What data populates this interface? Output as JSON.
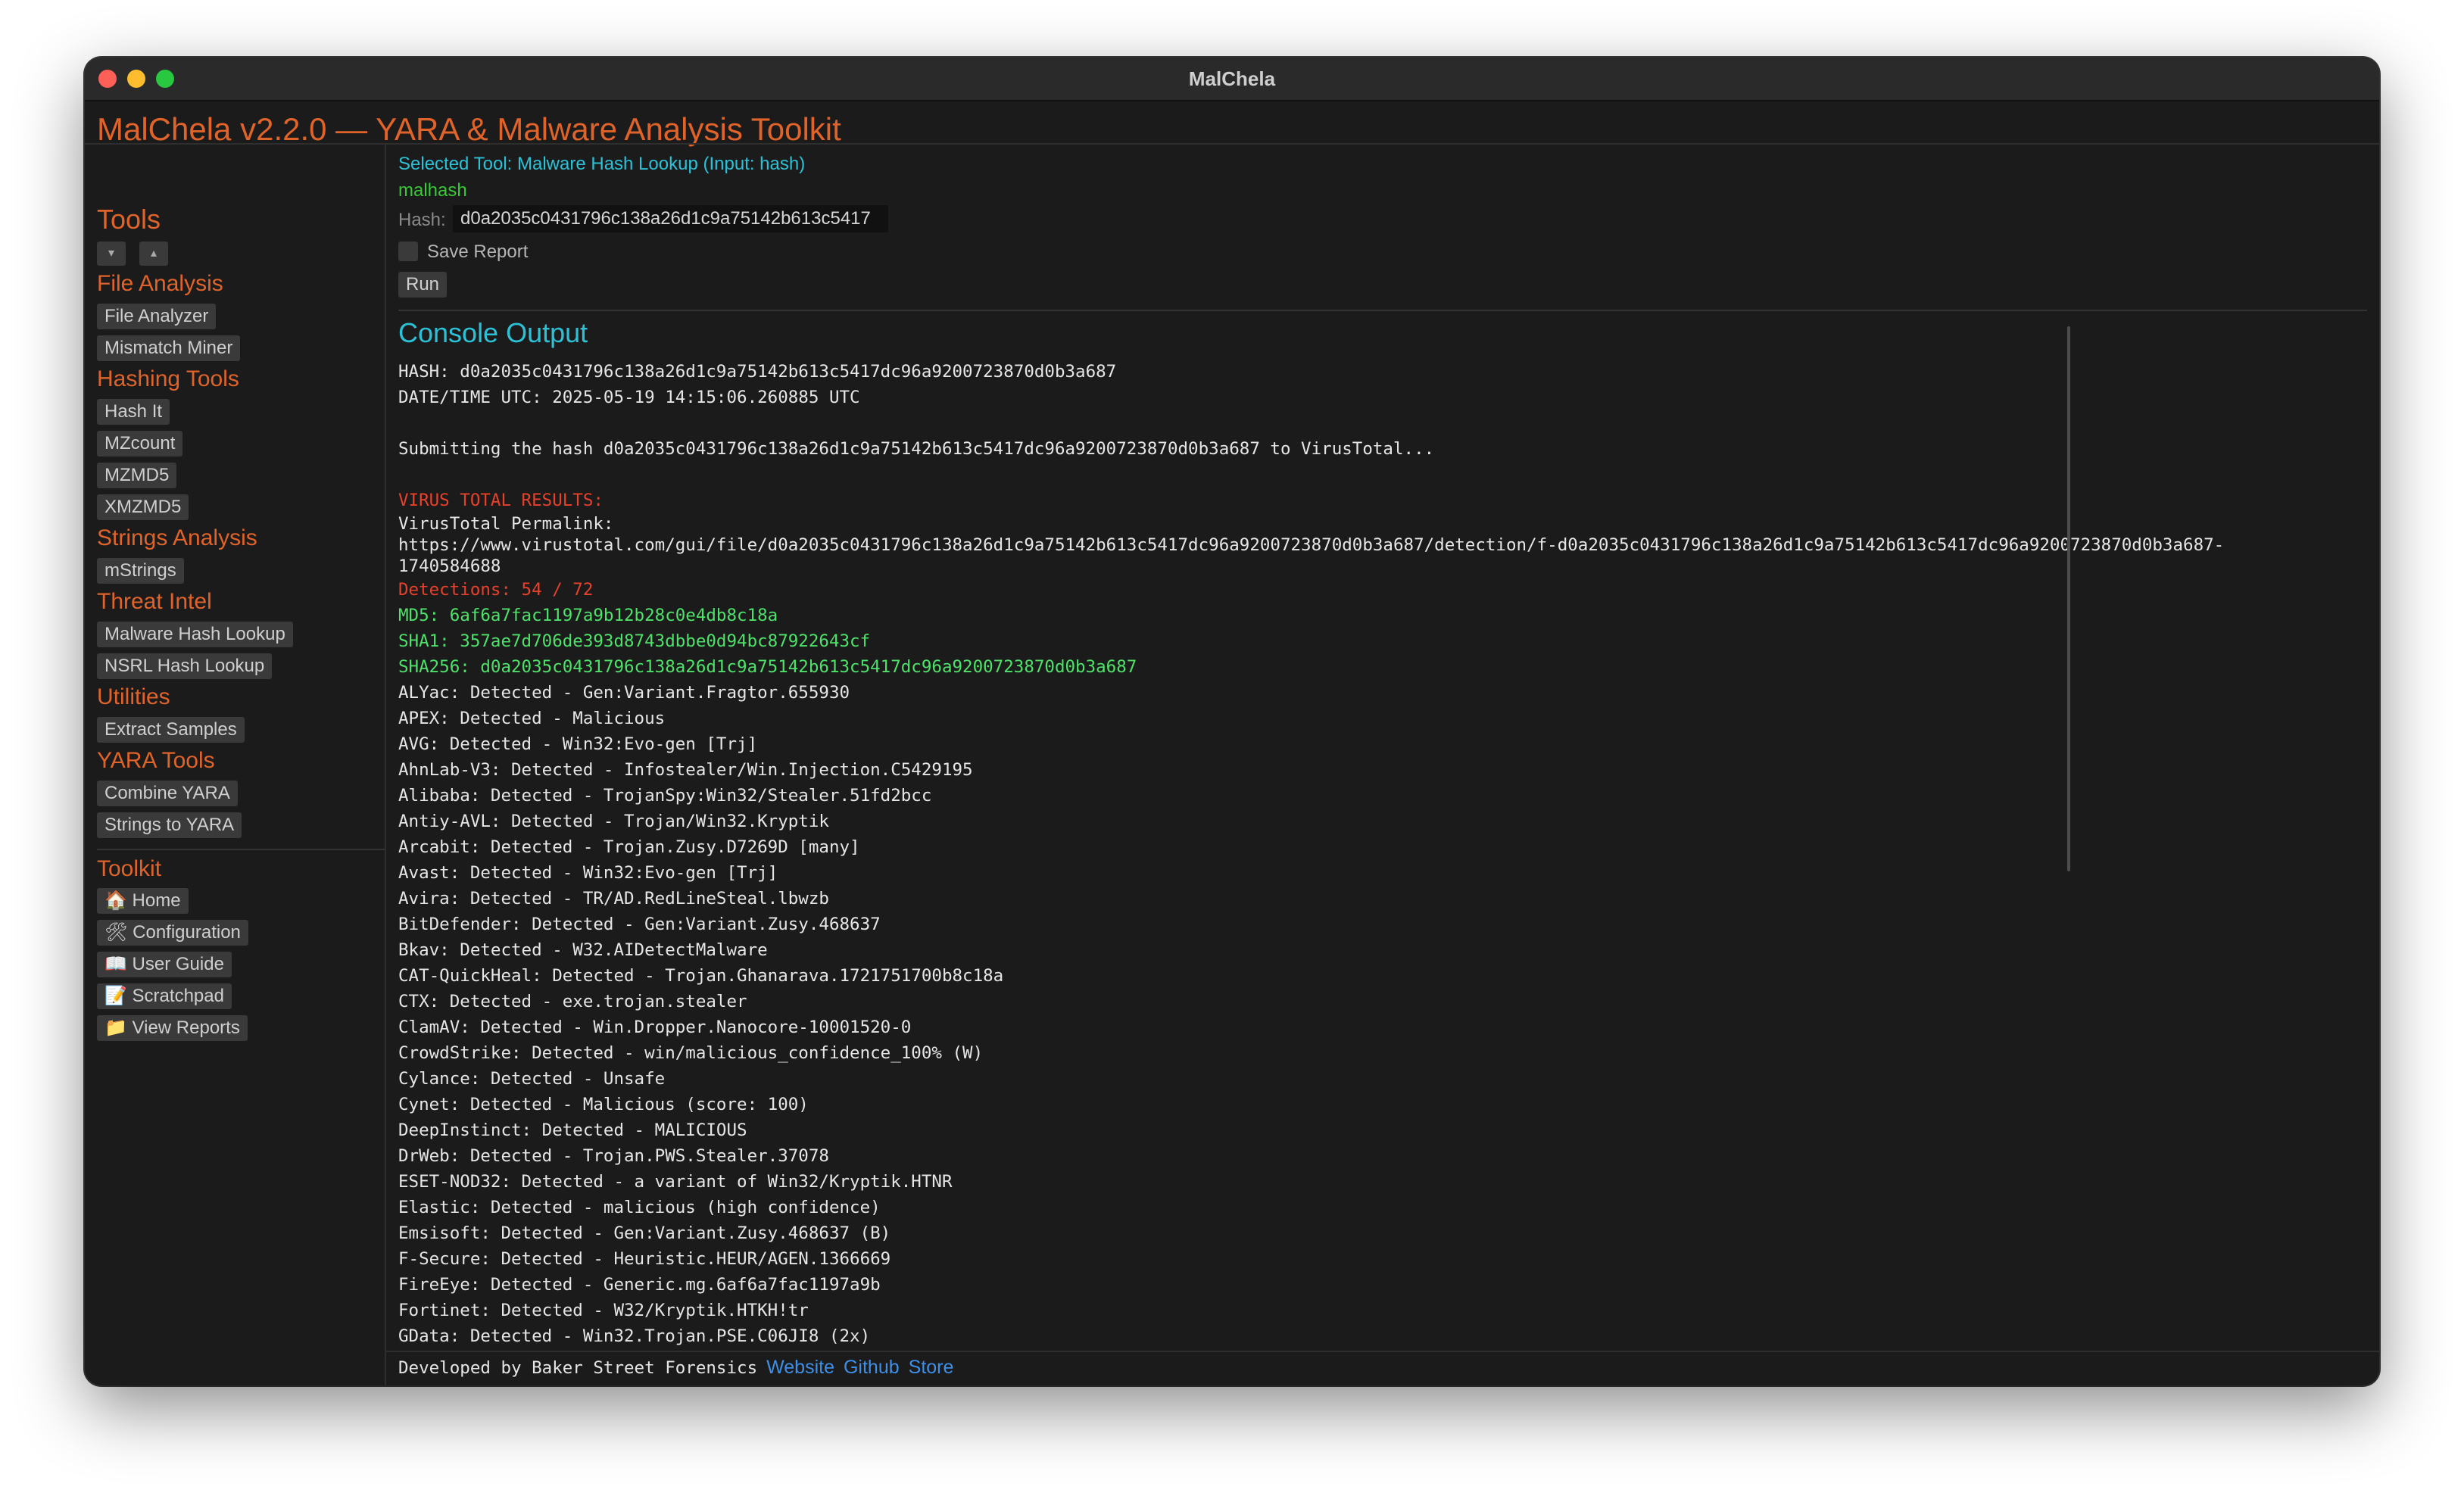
{
  "window": {
    "title": "MalChela",
    "app_title": "MalChela v2.2.0 — YARA & Malware Analysis Toolkit"
  },
  "sidebar": {
    "heading": "Tools",
    "collapse_icon": "▾",
    "expand_icon": "▴",
    "sections": {
      "file_analysis": "File Analysis",
      "hashing": "Hashing Tools",
      "strings": "Strings Analysis",
      "threat": "Threat Intel",
      "utilities": "Utilities",
      "yara": "YARA Tools",
      "toolkit": "Toolkit"
    },
    "tools": {
      "file_analyzer": "File Analyzer",
      "mismatch_miner": "Mismatch Miner",
      "hash_it": "Hash It",
      "mzcount": "MZcount",
      "mzmd5": "MZMD5",
      "xmzmd5": "XMZMD5",
      "mstrings": "mStrings",
      "malware_hash_lookup": "Malware Hash Lookup",
      "nsrl_hash_lookup": "NSRL Hash Lookup",
      "extract_samples": "Extract Samples",
      "combine_yara": "Combine YARA",
      "strings_to_yara": "Strings to YARA"
    },
    "toolkit": {
      "home": "🏠 Home",
      "configuration": "🛠 Configuration",
      "user_guide": "📖 User Guide",
      "scratchpad": "📝 Scratchpad",
      "view_reports": "📁 View Reports"
    }
  },
  "main": {
    "selected_tool": "Selected Tool: Malware Hash Lookup (Input: hash)",
    "tool_name": "malhash",
    "hash_label": "Hash:",
    "hash_value": "d0a2035c0431796c138a26d1c9a75142b613c5417",
    "save_report_label": "Save Report",
    "run_label": "Run",
    "console_title": "Console Output"
  },
  "console": {
    "hash_line": "HASH: d0a2035c0431796c138a26d1c9a75142b613c5417dc96a9200723870d0b3a687",
    "datetime_line": "DATE/TIME UTC: 2025-05-19 14:15:06.260885 UTC",
    "submit_line": "Submitting the hash d0a2035c0431796c138a26d1c9a75142b613c5417dc96a9200723870d0b3a687 to VirusTotal...",
    "vt_header": "VIRUS TOTAL RESULTS:",
    "permalink_label": "VirusTotal Permalink:",
    "permalink_1": "https://www.virustotal.com/gui/file/d0a2035c0431796c138a26d1c9a75142b613c5417dc96a9200723870d0b3a687/detection/f-d0a2035c0431796c138a26d1c9a75142b613c5417dc96a9200723870d0b3a687-",
    "permalink_2": "1740584688",
    "detections": "Detections: 54 / 72",
    "md5": "MD5: 6af6a7fac1197a9b12b28c0e4db8c18a",
    "sha1": "SHA1: 357ae7d706de393d8743dbbe0d94bc87922643cf",
    "sha256": "SHA256: d0a2035c0431796c138a26d1c9a75142b613c5417dc96a9200723870d0b3a687",
    "results": [
      "ALYac: Detected - Gen:Variant.Fragtor.655930",
      "APEX: Detected - Malicious",
      "AVG: Detected - Win32:Evo-gen [Trj]",
      "AhnLab-V3: Detected - Infostealer/Win.Injection.C5429195",
      "Alibaba: Detected - TrojanSpy:Win32/Stealer.51fd2bcc",
      "Antiy-AVL: Detected - Trojan/Win32.Kryptik",
      "Arcabit: Detected - Trojan.Zusy.D7269D [many]",
      "Avast: Detected - Win32:Evo-gen [Trj]",
      "Avira: Detected - TR/AD.RedLineSteal.lbwzb",
      "BitDefender: Detected - Gen:Variant.Zusy.468637",
      "Bkav: Detected - W32.AIDetectMalware",
      "CAT-QuickHeal: Detected - Trojan.Ghanarava.1721751700b8c18a",
      "CTX: Detected - exe.trojan.stealer",
      "ClamAV: Detected - Win.Dropper.Nanocore-10001520-0",
      "CrowdStrike: Detected - win/malicious_confidence_100% (W)",
      "Cylance: Detected - Unsafe",
      "Cynet: Detected - Malicious (score: 100)",
      "DeepInstinct: Detected - MALICIOUS",
      "DrWeb: Detected - Trojan.PWS.Stealer.37078",
      "ESET-NOD32: Detected - a variant of Win32/Kryptik.HTNR",
      "Elastic: Detected - malicious (high confidence)",
      "Emsisoft: Detected - Gen:Variant.Zusy.468637 (B)",
      "F-Secure: Detected - Heuristic.HEUR/AGEN.1366669",
      "FireEye: Detected - Generic.mg.6af6a7fac1197a9b",
      "Fortinet: Detected - W32/Kryptik.HTKH!tr",
      "GData: Detected - Win32.Trojan.PSE.C06JI8 (2x)"
    ]
  },
  "footer": {
    "developed_by": "Developed by Baker Street Forensics",
    "website": "Website",
    "github": "Github",
    "store": "Store"
  },
  "colors": {
    "accent_orange": "#e0642a",
    "cyan": "#2bc2d8",
    "green": "#38c838",
    "red": "#e8412b",
    "link_blue": "#3e8fe8",
    "background": "#1b1b1b"
  }
}
